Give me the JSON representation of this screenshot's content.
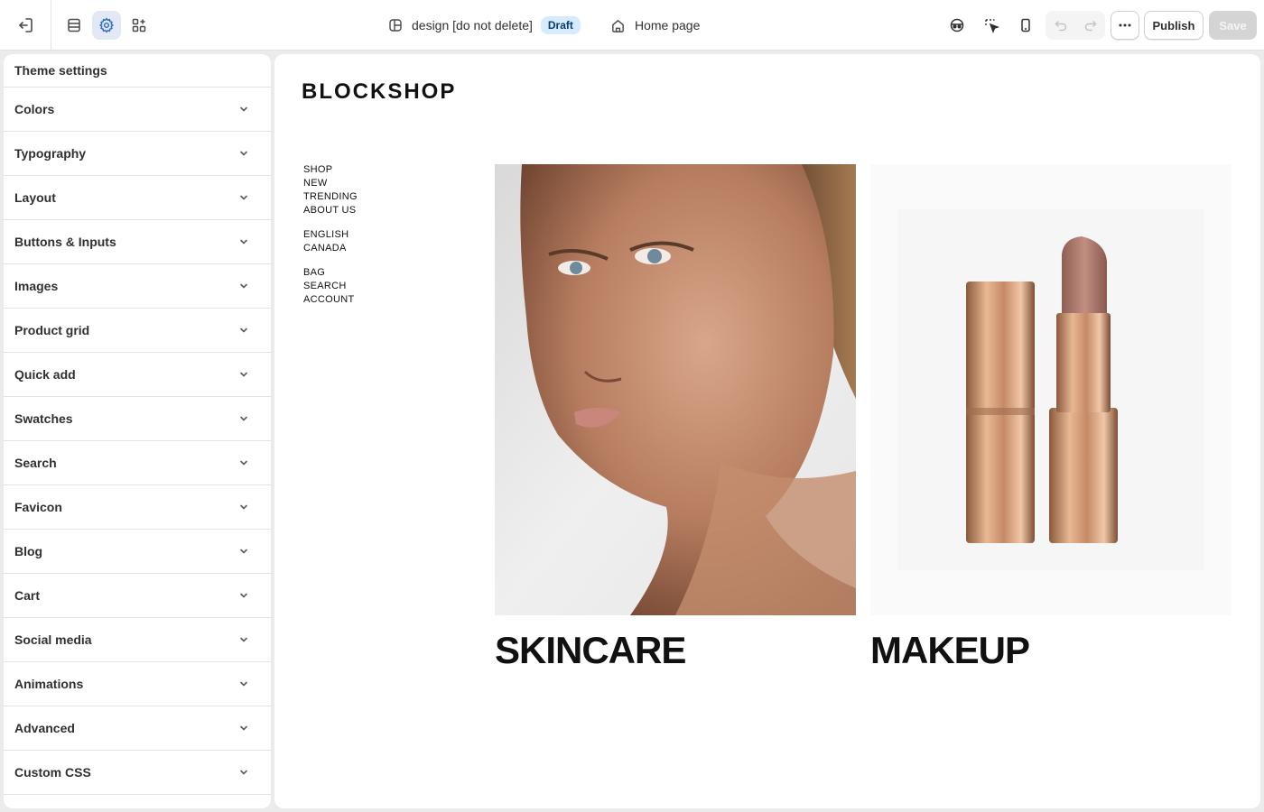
{
  "topbar": {
    "theme_name": "design [do not delete]",
    "theme_status": "Draft",
    "page_selector": "Home page",
    "publish_label": "Publish",
    "save_label": "Save"
  },
  "sidebar": {
    "title": "Theme settings",
    "items": [
      {
        "label": "Colors"
      },
      {
        "label": "Typography"
      },
      {
        "label": "Layout"
      },
      {
        "label": "Buttons & Inputs"
      },
      {
        "label": "Images"
      },
      {
        "label": "Product grid"
      },
      {
        "label": "Quick add"
      },
      {
        "label": "Swatches"
      },
      {
        "label": "Search"
      },
      {
        "label": "Favicon"
      },
      {
        "label": "Blog"
      },
      {
        "label": "Cart"
      },
      {
        "label": "Social media"
      },
      {
        "label": "Animations"
      },
      {
        "label": "Advanced"
      },
      {
        "label": "Custom CSS"
      }
    ]
  },
  "preview": {
    "logo": "BLOCKSHOP",
    "nav_primary": [
      "SHOP",
      "NEW",
      "TRENDING",
      "ABOUT US"
    ],
    "nav_locale": [
      "ENGLISH",
      "CANADA"
    ],
    "nav_utility": [
      "BAG",
      "SEARCH",
      "ACCOUNT"
    ],
    "collections": [
      {
        "title": "SKINCARE",
        "image": "woman-face-portrait"
      },
      {
        "title": "MAKEUP",
        "image": "lipstick-product"
      }
    ]
  },
  "colors": {
    "accent": "#2c6ecb",
    "active_bg": "#e3e8f5",
    "draft_badge_bg": "#d5ebff",
    "save_disabled_bg": "#d4d4d4"
  }
}
